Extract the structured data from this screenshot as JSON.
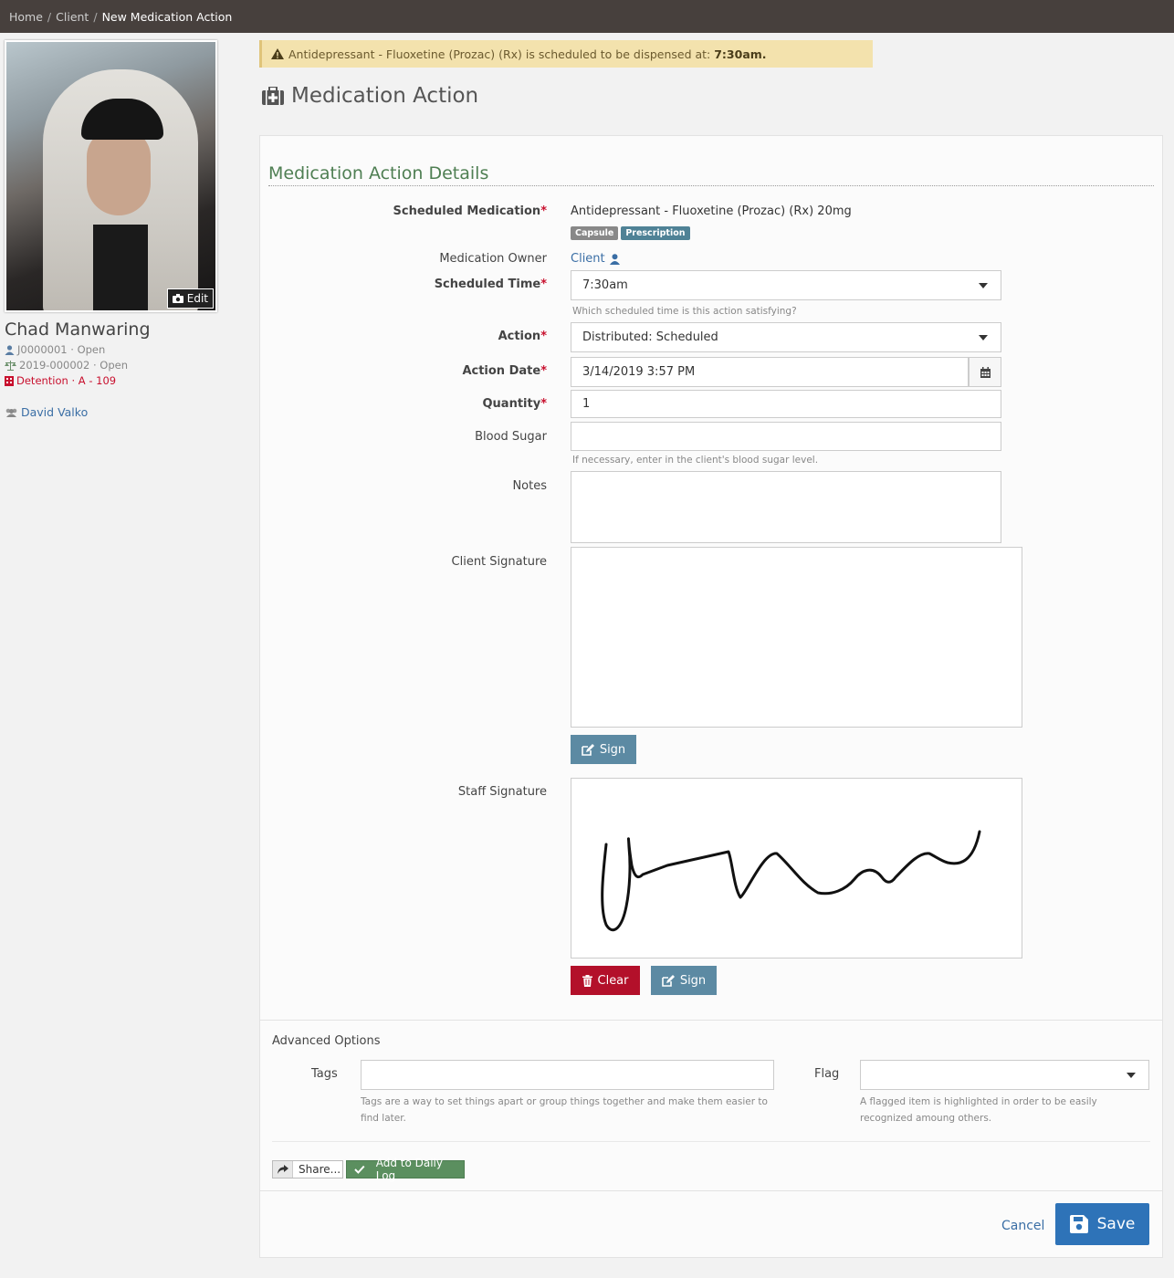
{
  "breadcrumb": {
    "items": [
      "Home",
      "Client"
    ],
    "separator": "/",
    "current": "New Medication Action"
  },
  "sidebar": {
    "edit_label": "Edit",
    "client_name": "Chad Manwaring",
    "case_id": "J0000001 · Open",
    "court_id": "2019-000002 · Open",
    "placement": "Detention · A - 109",
    "staff": "David Valko"
  },
  "alert": {
    "text": "Antidepressant - Fluoxetine (Prozac) (Rx) is scheduled to be dispensed at: ",
    "time": "7:30am."
  },
  "page_title": "Medication Action",
  "form": {
    "section_title": "Medication Action Details",
    "scheduled_medication": {
      "label": "Scheduled Medication",
      "value": "Antidepressant - Fluoxetine (Prozac) (Rx) 20mg",
      "badges": [
        {
          "text": "Capsule",
          "color": "#888888"
        },
        {
          "text": "Prescription",
          "color": "#4f8296"
        }
      ]
    },
    "medication_owner": {
      "label": "Medication Owner",
      "value": "Client"
    },
    "scheduled_time": {
      "label": "Scheduled Time",
      "value": "7:30am",
      "help": "Which scheduled time is this action satisfying?"
    },
    "action": {
      "label": "Action",
      "value": "Distributed: Scheduled"
    },
    "action_date": {
      "label": "Action Date",
      "value": "3/14/2019 3:57 PM"
    },
    "quantity": {
      "label": "Quantity",
      "value": "1"
    },
    "blood_sugar": {
      "label": "Blood Sugar",
      "value": "",
      "help": "If necessary, enter in the client's blood sugar level."
    },
    "notes": {
      "label": "Notes",
      "value": ""
    },
    "client_signature": {
      "label": "Client Signature",
      "sign_label": "Sign"
    },
    "staff_signature": {
      "label": "Staff Signature",
      "clear_label": "Clear",
      "sign_label": "Sign"
    },
    "required_mark": "*"
  },
  "advanced": {
    "title": "Advanced Options",
    "tags": {
      "label": "Tags",
      "value": "",
      "help": "Tags are a way to set things apart or group things together and make them easier to find later."
    },
    "flag": {
      "label": "Flag",
      "value": "",
      "help": "A flagged item is highlighted in order to be easily recognized amoung others."
    },
    "share_label": "Share...",
    "daily_log_label": "Add to Daily Log"
  },
  "footer": {
    "cancel_label": "Cancel",
    "save_label": "Save"
  },
  "colors": {
    "accent_green": "#4f7f53",
    "link_blue": "#3a6ea5",
    "danger_red": "#b3102a",
    "save_blue": "#2e73b8",
    "alert_bg": "#f3e2ad"
  }
}
